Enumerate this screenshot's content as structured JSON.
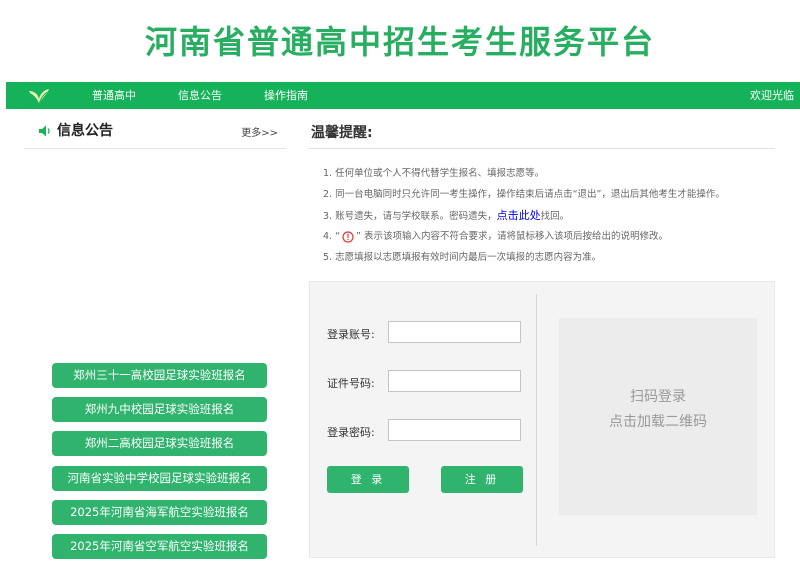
{
  "site": {
    "title": "河南省普通高中招生考生服务平台"
  },
  "nav": {
    "items": [
      "普通高中",
      "信息公告",
      "操作指南"
    ],
    "welcome": "欢迎光临"
  },
  "notices": {
    "title": "信息公告",
    "more": "更多>>",
    "buttons": [
      "郑州三十一高校园足球实验班报名",
      "郑州九中校园足球实验班报名",
      "郑州二高校园足球实验班报名",
      "河南省实验中学校园足球实验班报名",
      "2025年河南省海军航空实验班报名",
      "2025年河南省空军航空实验班报名"
    ]
  },
  "tips": {
    "title": "温馨提醒:",
    "items": {
      "t1": "1. 任何单位或个人不得代替学生报名、填报志愿等。",
      "t2": "2. 同一台电脑同时只允许同一考生操作，操作结束后请点击“退出”，退出后其他考生才能操作。",
      "t3_pre": "3. 账号遗失，请与学校联系。密码遗失，",
      "t3_link": "点击此处",
      "t3_post": "找回。",
      "t4_pre": "4. “",
      "t4_post": "” 表示该项输入内容不符合要求，请将鼠标移入该项后按给出的说明修改。",
      "t5": "5. 志愿填报以志愿填报有效时间内最后一次填报的志愿内容为准。"
    }
  },
  "login": {
    "account_label": "登录账号:",
    "id_label": "证件号码:",
    "password_label": "登录密码:",
    "login_button": "登 录",
    "register_button": "注 册",
    "qr_line1": "扫码登录",
    "qr_line2": "点击加载二维码"
  },
  "colors": {
    "brand": "#16b25a",
    "button": "#2fb36d",
    "title": "#27ae60"
  },
  "icons": {
    "logo": "leaf-logo-icon",
    "notice": "speaker-icon",
    "warning": "error-exclamation-icon"
  }
}
